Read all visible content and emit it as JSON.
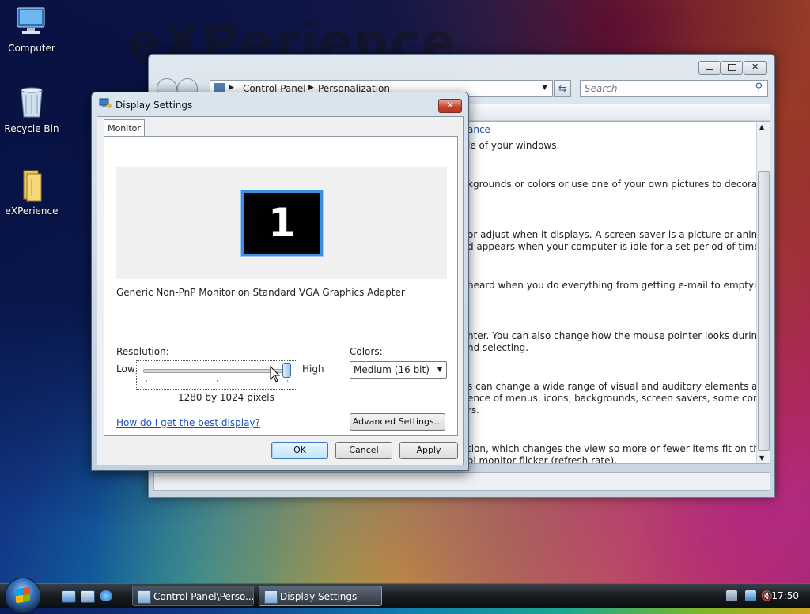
{
  "desktop": {
    "wallpaper_text": "eXPerience",
    "icons": [
      {
        "label": "Computer",
        "icon": "computer-icon"
      },
      {
        "label": "Recycle Bin",
        "icon": "recycle-bin-icon"
      },
      {
        "label": "eXPerience",
        "icon": "folder-icon"
      }
    ]
  },
  "control_panel": {
    "breadcrumb": [
      "Control Panel",
      "Personalization"
    ],
    "search_placeholder": "Search",
    "header_fragment": "ance",
    "content_lines": [
      "le of your windows.",
      "kgrounds or colors or use one of your own pictures to decorate",
      "or adjust when it displays. A screen saver is a picture or animation",
      "d appears when your computer is idle for a set period of time.",
      "heard when you do everything from getting e-mail to emptying",
      "nter. You can also change how the mouse pointer looks during",
      "nd selecting.",
      "s can change a wide range of visual and auditory elements at one",
      "ence of menus, icons, backgrounds, screen savers, some computer",
      "rs.",
      "tion, which changes the view so more or fewer items fit on the",
      "ol monitor flicker (refresh rate)."
    ]
  },
  "dialog": {
    "title": "Display Settings",
    "close_label": "✕",
    "tab": "Monitor",
    "monitor_number": "1",
    "monitor_description": "Generic Non-PnP Monitor on Standard VGA Graphics Adapter",
    "resolution_label": "Resolution:",
    "low_label": "Low",
    "high_label": "High",
    "resolution_value": "1280 by 1024 pixels",
    "resolution_slider_fraction": 1.0,
    "colors_label": "Colors:",
    "colors_value": "Medium (16 bit)",
    "help_link": "How do I get the best display?",
    "advanced_button": "Advanced Settings...",
    "ok_button": "OK",
    "cancel_button": "Cancel",
    "apply_button": "Apply"
  },
  "taskbar": {
    "buttons": [
      {
        "label": "Control Panel\\Perso...",
        "active": false
      },
      {
        "label": "Display Settings",
        "active": true
      }
    ],
    "clock": "17:50"
  },
  "colors": {
    "selection_blue": "#3a8ee6",
    "link_blue": "#1b4fb8",
    "close_red": "#c7412a"
  }
}
